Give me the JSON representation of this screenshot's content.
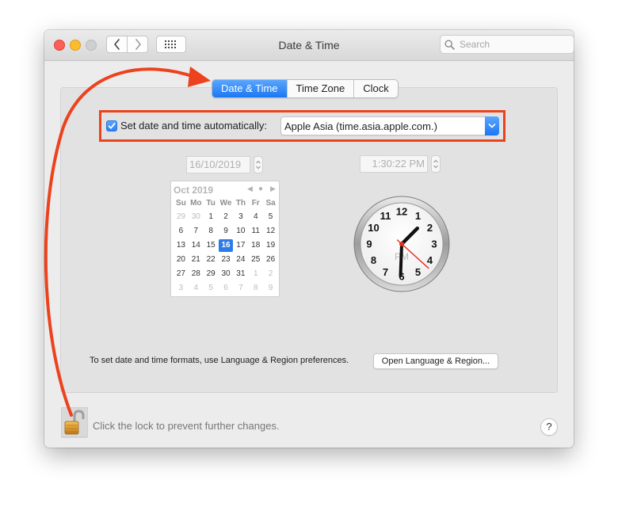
{
  "window": {
    "title": "Date & Time",
    "search_placeholder": "Search"
  },
  "tabs": [
    {
      "label": "Date & Time",
      "active": true
    },
    {
      "label": "Time Zone",
      "active": false
    },
    {
      "label": "Clock",
      "active": false
    }
  ],
  "auto": {
    "checked": true,
    "label": "Set date and time automatically:",
    "server": "Apple Asia (time.asia.apple.com.)"
  },
  "date_field": "16/10/2019",
  "time_field": "1:30:22 PM",
  "calendar": {
    "month": "Oct 2019",
    "weekdays": [
      "Su",
      "Mo",
      "Tu",
      "We",
      "Th",
      "Fr",
      "Sa"
    ],
    "weeks": [
      [
        "29",
        "30",
        "1",
        "2",
        "3",
        "4",
        "5"
      ],
      [
        "6",
        "7",
        "8",
        "9",
        "10",
        "11",
        "12"
      ],
      [
        "13",
        "14",
        "15",
        "16",
        "17",
        "18",
        "19"
      ],
      [
        "20",
        "21",
        "22",
        "23",
        "24",
        "25",
        "26"
      ],
      [
        "27",
        "28",
        "29",
        "30",
        "31",
        "1",
        "2"
      ],
      [
        "3",
        "4",
        "5",
        "6",
        "7",
        "8",
        "9"
      ]
    ],
    "selected_day": "16"
  },
  "clock": {
    "numerals": [
      "12",
      "1",
      "2",
      "3",
      "4",
      "5",
      "6",
      "7",
      "8",
      "9",
      "10",
      "11"
    ],
    "ampm": "PM",
    "hour": 1,
    "minute": 30,
    "second": 22
  },
  "formats": {
    "text": "To set date and time formats, use Language & Region preferences.",
    "button": "Open Language & Region..."
  },
  "lock": {
    "text": "Click the lock to prevent further changes."
  },
  "help": "?",
  "colors": {
    "accent": "#1b78f2",
    "annotation": "#ec421d"
  },
  "icons": {
    "back": "chevron-left-icon",
    "forward": "chevron-right-icon",
    "grid": "grid-icon",
    "search": "search-icon",
    "lock": "lock-open-icon",
    "checkbox": "checkmark-icon",
    "select": "chevron-down-icon"
  }
}
